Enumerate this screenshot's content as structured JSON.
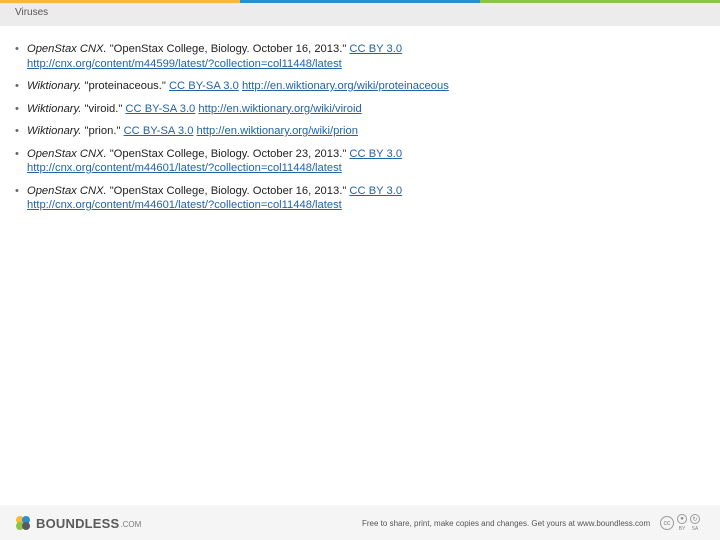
{
  "topbar_colors": [
    "#f5b93a",
    "#2c8fc9",
    "#8cc34a"
  ],
  "header": {
    "title": "Viruses"
  },
  "references": [
    {
      "source": "OpenStax CNX.",
      "text": " \"OpenStax College, Biology. October 16, 2013.\" ",
      "license": "CC BY 3.0",
      "url": "http://cnx.org/content/m44599/latest/?collection=col11448/latest"
    },
    {
      "source": "Wiktionary.",
      "text": " \"proteinaceous.\" ",
      "license": "CC BY-SA 3.0",
      "url": "http://en.wiktionary.org/wiki/proteinaceous"
    },
    {
      "source": "Wiktionary.",
      "text": " \"viroid.\" ",
      "license": "CC BY-SA 3.0",
      "url": "http://en.wiktionary.org/wiki/viroid"
    },
    {
      "source": "Wiktionary.",
      "text": " \"prion.\" ",
      "license": "CC BY-SA 3.0",
      "url": "http://en.wiktionary.org/wiki/prion"
    },
    {
      "source": "OpenStax CNX.",
      "text": " \"OpenStax College, Biology. October 23, 2013.\" ",
      "license": "CC BY 3.0",
      "url": "http://cnx.org/content/m44601/latest/?collection=col11448/latest"
    },
    {
      "source": "OpenStax CNX.",
      "text": " \"OpenStax College, Biology. October 16, 2013.\" ",
      "license": "CC BY 3.0",
      "url": "http://cnx.org/content/m44601/latest/?collection=col11448/latest"
    }
  ],
  "bullet": "•",
  "footer": {
    "logo_word": "BOUNDLESS",
    "logo_tld": ".COM",
    "tagline": "Free to share, print, make copies and changes. Get yours at www.boundless.com",
    "cc_main": "cc",
    "cc_by": "BY",
    "cc_sa": "SA"
  }
}
